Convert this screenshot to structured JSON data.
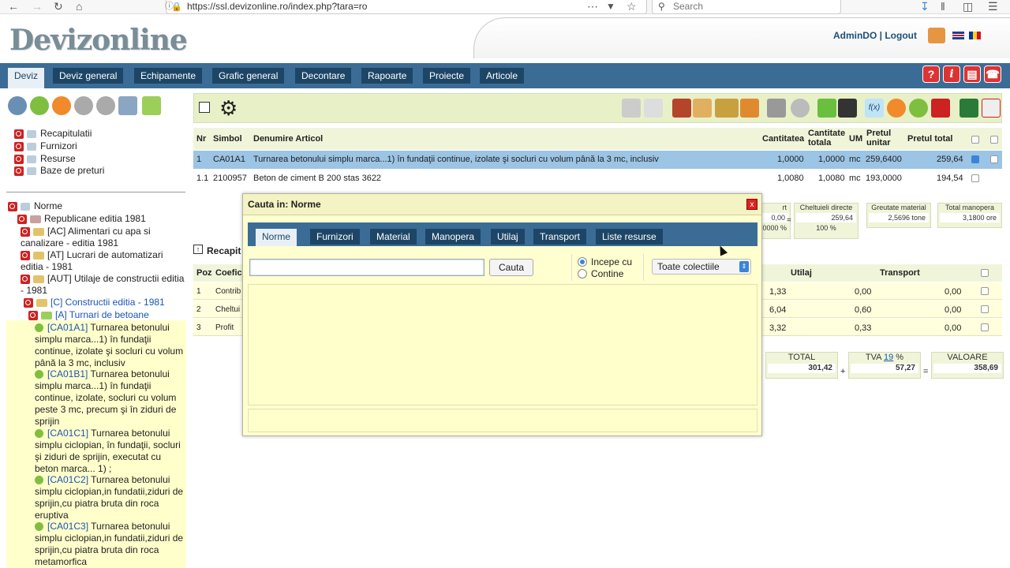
{
  "browser": {
    "url": "https://ssl.devizonline.ro/index.php?tara=ro",
    "search_placeholder": "Search"
  },
  "header": {
    "logo": "Devizonline",
    "user": "AdminDO",
    "separator": "|",
    "logout": "Logout"
  },
  "nav": {
    "tabs": [
      "Deviz",
      "Deviz general",
      "Echipamente",
      "Grafic general",
      "Decontare",
      "Rapoarte",
      "Proiecte",
      "Articole"
    ],
    "help": "?",
    "info": "i"
  },
  "sidebar": {
    "items": [
      "Recapitulatii",
      "Furnizori",
      "Resurse",
      "Baze de preturi"
    ],
    "tree": {
      "root": "Norme",
      "republicane": "Republicane editia 1981",
      "ac": "[AC] Alimentari cu apa si canalizare - editia 1981",
      "at": "[AT] Lucrari de automatizari editia - 1981",
      "aut": "[AUT] Utilaje de constructii editia - 1981",
      "c": "[C] Constructii editia - 1981",
      "a": "[A] Turnari de betoane"
    },
    "articles": [
      {
        "code": "[CA01A1]",
        "text": " Turnarea betonului simplu marca...1) în fundaţii continue, izolate şi socluri cu volum până la 3 mc, inclusiv"
      },
      {
        "code": "[CA01B1]",
        "text": " Turnarea betonului simplu marca...1) în fundaţii continue, izolate, socluri cu volum peste 3 mc, precum şi în ziduri de sprijin"
      },
      {
        "code": "[CA01C1]",
        "text": " Turnarea betonului simplu ciclopian, în fundaţii, socluri şi ziduri de sprijin, executat cu beton marca... 1) ;"
      },
      {
        "code": "[CA01C2]",
        "text": " Turnarea betonului simplu ciclopian,in fundatii,ziduri de sprijin,cu piatra bruta din roca eruptiva"
      },
      {
        "code": "[CA01C3]",
        "text": " Turnarea betonului simplu ciclopian,in fundatii,ziduri de sprijin,cu piatra bruta din roca metamorfica"
      }
    ]
  },
  "table": {
    "headers": {
      "nr": "Nr",
      "simbol": "Simbol",
      "denumire": "Denumire Articol",
      "cantitatea": "Cantitatea",
      "cant_totala": "Cantitate totala",
      "um": "UM",
      "pret_unitar": "Pretul unitar",
      "pret_total": "Pretul total"
    },
    "rows": [
      {
        "nr": "1",
        "simbol": "CA01A1",
        "denumire": "Turnarea betonului simplu marca...1) în fundaţii continue, izolate şi socluri cu volum până la 3 mc, inclusiv",
        "cantitatea": "1,0000",
        "cant_totala": "1,0000",
        "um": "mc",
        "pret_unitar": "259,6400",
        "pret_total": "259,64"
      },
      {
        "nr": "1.1",
        "simbol": "2100957",
        "denumire": "Beton de ciment B 200 stas 3622",
        "cantitatea": "1,0080",
        "cant_totala": "1,0080",
        "um": "mc",
        "pret_unitar": "193,0000",
        "pret_total": "194,54"
      }
    ]
  },
  "summary": {
    "boxes": [
      {
        "label": "rt",
        "value": "0,00",
        "pct": "0000 %"
      },
      {
        "label": "Cheltuieli directe",
        "value": "259,64",
        "pct": "100 %"
      },
      {
        "label": "Greutate material",
        "value": "2,5696 tone"
      },
      {
        "label": "Total manopera",
        "value": "3,1800 ore"
      }
    ],
    "eq": "="
  },
  "recap": {
    "title": "Recapit",
    "headers": {
      "poz": "Poz",
      "coef": "Coefic",
      "utilaj": "Utilaj",
      "transport": "Transport"
    },
    "rows": [
      {
        "poz": "1",
        "name": "Contrib",
        "v1": "1,33",
        "utilaj": "0,00",
        "transport": "0,00"
      },
      {
        "poz": "2",
        "name": "Cheltui",
        "v1": "6,04",
        "utilaj": "0,60",
        "transport": "0,00"
      },
      {
        "poz": "3",
        "name": "Profit",
        "v1": "3,32",
        "utilaj": "0,33",
        "transport": "0,00"
      }
    ]
  },
  "totals": {
    "total_label": "TOTAL",
    "total_value": "301,42",
    "plus": "+",
    "tva_label": "TVA",
    "tva_rate": "19",
    "tva_pct": "%",
    "tva_value": "57,27",
    "equals": "=",
    "valoare_label": "VALOARE",
    "valoare_value": "358,69"
  },
  "modal": {
    "title": "Cauta in: Norme",
    "close": "x",
    "tabs": [
      "Norme",
      "Furnizori",
      "Material",
      "Manopera",
      "Utilaj",
      "Transport",
      "Liste resurse"
    ],
    "search_value": "",
    "search_button": "Cauta",
    "radio_starts": "Incepe cu",
    "radio_contains": "Contine",
    "select_value": "Toate colectiile"
  },
  "colors": {
    "nav_bg": "#3b6c96",
    "tab_bg": "#1d4666",
    "selected_row": "#9cc4e4",
    "toolbar_bg": "#e8f0c8",
    "modal_bg": "#ffffd0"
  }
}
